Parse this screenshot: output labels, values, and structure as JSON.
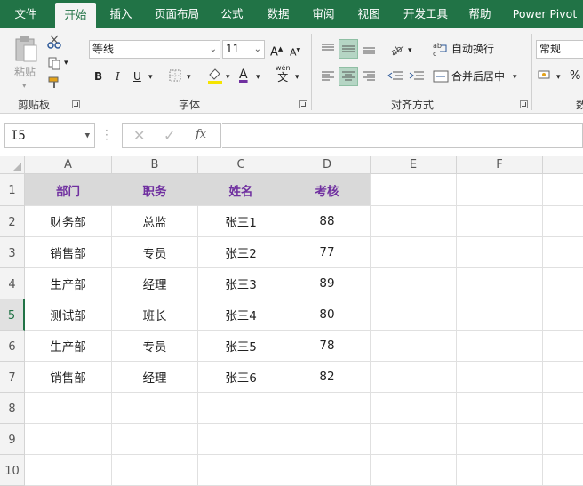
{
  "tabs": [
    {
      "label": "文件",
      "active": false
    },
    {
      "label": "开始",
      "active": true
    },
    {
      "label": "插入",
      "active": false
    },
    {
      "label": "页面布局",
      "active": false
    },
    {
      "label": "公式",
      "active": false
    },
    {
      "label": "数据",
      "active": false
    },
    {
      "label": "审阅",
      "active": false
    },
    {
      "label": "视图",
      "active": false
    },
    {
      "label": "开发工具",
      "active": false
    },
    {
      "label": "帮助",
      "active": false
    },
    {
      "label": "Power Pivot",
      "active": false
    }
  ],
  "ribbon": {
    "clipboard": {
      "label": "剪贴板",
      "paste_label": "粘贴"
    },
    "font": {
      "label": "字体",
      "font_name": "等线",
      "font_size": "11",
      "bold": "B",
      "italic": "I",
      "underline": "U",
      "grow": "A",
      "shrink": "A",
      "font_color_letter": "A",
      "phonetic_top": "wén",
      "phonetic_bottom": "文",
      "font_color": "#7030a0"
    },
    "alignment": {
      "label": "对齐方式",
      "wrap_text": "自动换行",
      "merge_center": "合并后居中"
    },
    "number": {
      "label": "数",
      "format": "常规",
      "percent": "%"
    }
  },
  "formula_bar": {
    "name_box": "I5",
    "fx": "fx",
    "formula": ""
  },
  "columns": [
    "A",
    "B",
    "C",
    "D",
    "E",
    "F"
  ],
  "rows": [
    "1",
    "2",
    "3",
    "4",
    "5",
    "6",
    "7",
    "8",
    "9",
    "10"
  ],
  "table": {
    "headers": [
      "部门",
      "职务",
      "姓名",
      "考核"
    ],
    "rows": [
      [
        "财务部",
        "总监",
        "张三1",
        "88"
      ],
      [
        "销售部",
        "专员",
        "张三2",
        "77"
      ],
      [
        "生产部",
        "经理",
        "张三3",
        "89"
      ],
      [
        "测试部",
        "班长",
        "张三4",
        "80"
      ],
      [
        "生产部",
        "专员",
        "张三5",
        "78"
      ],
      [
        "销售部",
        "经理",
        "张三6",
        "82"
      ]
    ]
  },
  "colors": {
    "brand": "#217346",
    "header_fill": "#d9d9d9",
    "header_text": "#7030a0"
  }
}
